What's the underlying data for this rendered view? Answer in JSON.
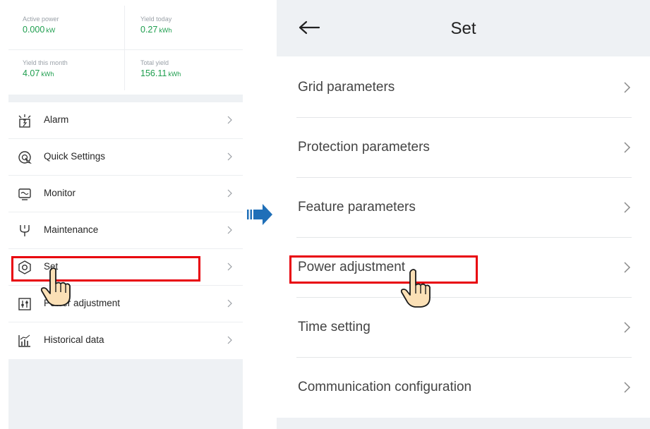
{
  "left": {
    "stats": [
      {
        "label": "Active power",
        "value": "0.000",
        "unit": "kW"
      },
      {
        "label": "Yield today",
        "value": "0.27",
        "unit": "kWh"
      },
      {
        "label": "Yield this month",
        "value": "4.07",
        "unit": "kWh"
      },
      {
        "label": "Total yield",
        "value": "156.11",
        "unit": "kWh"
      }
    ],
    "menu": [
      {
        "label": "Alarm",
        "icon": "alarm-icon"
      },
      {
        "label": "Quick Settings",
        "icon": "quick-settings-icon"
      },
      {
        "label": "Monitor",
        "icon": "monitor-icon"
      },
      {
        "label": "Maintenance",
        "icon": "maintenance-icon"
      },
      {
        "label": "Set",
        "icon": "settings-hex-icon"
      },
      {
        "label": "Power adjustment",
        "icon": "power-adjustment-icon"
      },
      {
        "label": "Historical data",
        "icon": "historical-data-icon"
      }
    ]
  },
  "right": {
    "title": "Set",
    "items": [
      {
        "label": "Grid parameters"
      },
      {
        "label": "Protection parameters"
      },
      {
        "label": "Feature parameters"
      },
      {
        "label": "Power adjustment"
      },
      {
        "label": "Time setting"
      },
      {
        "label": "Communication configuration"
      }
    ]
  },
  "colors": {
    "accent_green": "#1e9e4e",
    "highlight_red": "#e8000b",
    "arrow_blue": "#1f6fb8",
    "panel_grey": "#eef1f4"
  }
}
